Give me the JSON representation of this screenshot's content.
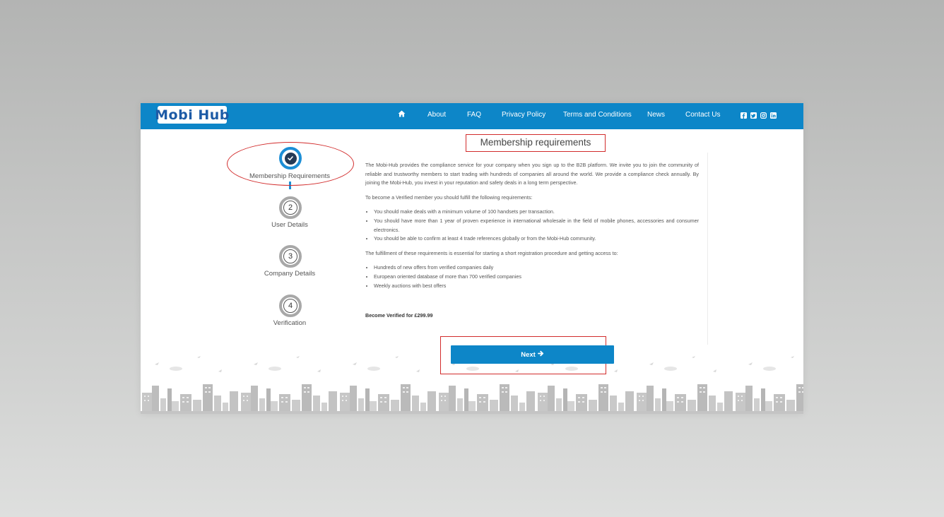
{
  "navbar": {
    "logo": "Mobi Hub",
    "home_icon": "home-icon",
    "links": [
      "About",
      "FAQ",
      "Privacy Policy",
      "Terms and Conditions",
      "News",
      "Contact Us"
    ],
    "social_icons": [
      "facebook-icon",
      "twitter-icon",
      "instagram-icon",
      "linkedin-icon"
    ]
  },
  "steps": [
    {
      "number": "",
      "label": "Membership Requirements",
      "state": "completed"
    },
    {
      "number": "2",
      "label": "User Details",
      "state": "pending"
    },
    {
      "number": "3",
      "label": "Company Details",
      "state": "pending"
    },
    {
      "number": "4",
      "label": "Verification",
      "state": "pending"
    }
  ],
  "main": {
    "title": "Membership requirements",
    "intro": "The Mobi-Hub provides the compliance service for your company when you sign up to the B2B platform. We invite you to join the community of reliable and trustworthy members to start trading with hundreds of companies all around the world. We provide a compliance check annually. By joining the Mobi-Hub, you invest in your reputation and safety deals in a long term perspective.",
    "requirements_heading": "To become a Verified member you should fulfill the following requirements:",
    "requirements": [
      "You should make deals with a minimum volume of 100 handsets per transaction.",
      "You should have more than 1 year of proven experience in international wholesale in the field of mobile phones, accessories and consumer electronics.",
      "You should be able to confirm at least 4 trade references globally or from the Mobi-Hub community."
    ],
    "benefits_heading": "The fulfillment of these requirements is essential for starting a short registration procedure and getting access to:",
    "benefits": [
      "Hundreds of new offers from verified companies daily",
      "European oriented database of more than 700 verified companies",
      "Weekly auctions with best offers"
    ],
    "price_text": "Become Verified for £299.99",
    "next_label": "Next"
  },
  "colors": {
    "brand_blue": "#0d86c8",
    "annotation_red": "#d22c2c",
    "step_active": "#1c8ed6",
    "step_pending": "#a8a8a8"
  }
}
